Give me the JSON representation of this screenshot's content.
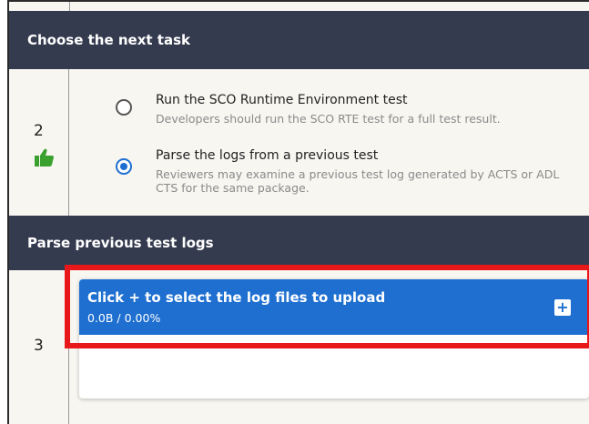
{
  "sections": {
    "next_task": {
      "header": "Choose the next task",
      "step_number": "2",
      "options": [
        {
          "title": "Run the SCO Runtime Environment test",
          "description": "Developers should run the SCO RTE test for a full test result.",
          "selected": false
        },
        {
          "title": "Parse the logs from a previous test",
          "description": "Reviewers may examine a previous test log generated by ACTS or ADL CTS for the same package.",
          "selected": true
        }
      ],
      "status_icon": "thumbs-up-icon"
    },
    "parse_logs": {
      "header": "Parse previous test logs",
      "step_number": "3",
      "upload": {
        "title": "Click + to select the log files to upload",
        "progress": "0.0B / 0.00%",
        "add_icon": "plus-icon"
      }
    }
  },
  "colors": {
    "header_bg": "#353b4f",
    "row_bg": "#f8f6f1",
    "accent": "#1e6fd0",
    "success": "#3aa12f",
    "highlight": "#e8171a"
  }
}
